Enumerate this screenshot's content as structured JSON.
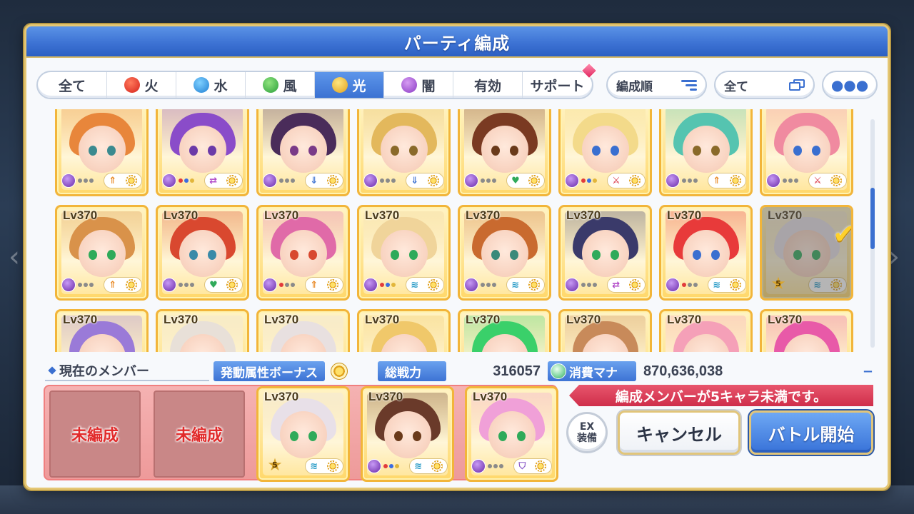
{
  "title": "パーティ編成",
  "tabs": [
    {
      "label": "全て",
      "icon": ""
    },
    {
      "label": "火",
      "icon": "fire-icon"
    },
    {
      "label": "水",
      "icon": "water-icon"
    },
    {
      "label": "風",
      "icon": "wind-icon"
    },
    {
      "label": "光",
      "icon": "light-icon",
      "active": true
    },
    {
      "label": "闇",
      "icon": "dark-icon"
    },
    {
      "label": "有効",
      "icon": ""
    },
    {
      "label": "サポート",
      "icon": ""
    }
  ],
  "sort_label": "編成順",
  "filter_label": "全て",
  "level_label": "Lv370",
  "rows": [
    {
      "show_level": false,
      "cards": [
        {
          "hair": "#e8863b",
          "eye": "#3b8a8f",
          "role": "up-arrow",
          "role_color": "#e8861f",
          "dots": [
            "g",
            "g",
            "g"
          ]
        },
        {
          "hair": "#8a4cc9",
          "eye": "#6b3aa8",
          "role": "swap",
          "role_color": "#b048c8",
          "dots": [
            "r",
            "b",
            "y"
          ]
        },
        {
          "hair": "#4a2c5a",
          "eye": "#7a3a88",
          "role": "down-arrow",
          "role_color": "#3a6fd0",
          "dots": [
            "g",
            "g",
            "g"
          ]
        },
        {
          "hair": "#e3b85c",
          "eye": "#8a6a2a",
          "role": "down-arrow",
          "role_color": "#3a6fd0",
          "dots": [
            "g",
            "g",
            "g"
          ]
        },
        {
          "hair": "#7a3a22",
          "eye": "#6a3a1a",
          "role": "heart",
          "role_color": "#2faa5a",
          "dots": [
            "g",
            "g",
            "g"
          ]
        },
        {
          "hair": "#f3da8a",
          "eye": "#3a6fd0",
          "role": "sword",
          "role_color": "#d82a3a",
          "dots": [
            "r",
            "b",
            "y"
          ]
        },
        {
          "hair": "#55c4b0",
          "eye": "#8a6a2a",
          "role": "up-arrow",
          "role_color": "#e8861f",
          "dots": [
            "g",
            "g",
            "g"
          ]
        },
        {
          "hair": "#f08aa0",
          "eye": "#3a6fd0",
          "role": "sword",
          "role_color": "#d82a3a",
          "dots": [
            "g",
            "g",
            "g"
          ]
        }
      ]
    },
    {
      "show_level": true,
      "cards": [
        {
          "hair": "#d9924a",
          "eye": "#2faa5a",
          "role": "up-arrow",
          "role_color": "#e8861f",
          "dots": [
            "g",
            "g",
            "g"
          ]
        },
        {
          "hair": "#d9482f",
          "eye": "#3a8aa8",
          "role": "heart",
          "role_color": "#2faa5a",
          "dots": [
            "g",
            "g",
            "g"
          ]
        },
        {
          "hair": "#e06aa8",
          "eye": "#d8482f",
          "role": "up-arrow",
          "role_color": "#e8861f",
          "dots": [
            "r",
            "g",
            "g"
          ]
        },
        {
          "hair": "#f0d49a",
          "eye": "#2faa5a",
          "role": "wing",
          "role_color": "#2a9cc8",
          "dots": [
            "r",
            "b",
            "y"
          ]
        },
        {
          "hair": "#c96a2f",
          "eye": "#3a8a7a",
          "role": "wing",
          "role_color": "#2a9cc8",
          "dots": [
            "g",
            "g",
            "g"
          ]
        },
        {
          "hair": "#3a3a6a",
          "eye": "#2faa5a",
          "role": "swap",
          "role_color": "#b048c8",
          "dots": [
            "g",
            "g",
            "g"
          ]
        },
        {
          "hair": "#e83a3a",
          "eye": "#3a6fd0",
          "role": "wing",
          "role_color": "#2a9cc8",
          "dots": [
            "r",
            "g",
            "g"
          ]
        },
        {
          "hair": "#e8e0e8",
          "eye": "#2faa5a",
          "role": "wing",
          "role_color": "#2a9cc8",
          "dots": [],
          "selected": true,
          "star": "5"
        }
      ]
    },
    {
      "show_level": true,
      "cards": [
        {
          "hair": "#9a7ad8",
          "eye": "#6a3aa8",
          "role": "",
          "role_color": "#888",
          "dots": []
        },
        {
          "hair": "#e8e0d8",
          "eye": "#8a6a2a",
          "role": "",
          "role_color": "#888",
          "dots": []
        },
        {
          "hair": "#e8e0e0",
          "eye": "#8a6a2a",
          "role": "",
          "role_color": "#888",
          "dots": []
        },
        {
          "hair": "#f0c86a",
          "eye": "#3a8a7a",
          "role": "",
          "role_color": "#888",
          "dots": []
        },
        {
          "hair": "#3ad06a",
          "eye": "#2a8a5a",
          "role": "",
          "role_color": "#888",
          "dots": []
        },
        {
          "hair": "#c88a5a",
          "eye": "#6a3a1a",
          "role": "",
          "role_color": "#888",
          "dots": []
        },
        {
          "hair": "#f5a0b8",
          "eye": "#8a3a6a",
          "role": "",
          "role_color": "#888",
          "dots": []
        },
        {
          "hair": "#e85aa8",
          "eye": "#8a3a6a",
          "role": "",
          "role_color": "#888",
          "dots": []
        }
      ]
    }
  ],
  "info": {
    "current_members": "現在のメンバー",
    "bonus_label": "発動属性ボーナス",
    "power_label": "総戦力",
    "power_value": "316057",
    "mana_label": "消費マナ",
    "mana_value": "870,636,038",
    "collapse": "−"
  },
  "party": {
    "empty_label": "未編成",
    "members": [
      {
        "hair": "#e8e0e8",
        "eye": "#2faa5a",
        "role": "wing",
        "role_color": "#2a9cc8",
        "dots": [],
        "star": "5"
      },
      {
        "hair": "#6a3a2a",
        "eye": "#6a3a1a",
        "role": "wing",
        "role_color": "#2a9cc8",
        "dots": [
          "r",
          "b",
          "y"
        ]
      },
      {
        "hair": "#f0a0d8",
        "eye": "#2faa5a",
        "role": "shield",
        "role_color": "#8a5ac8",
        "dots": [
          "g",
          "g",
          "g"
        ]
      }
    ]
  },
  "warning": "編成メンバーが5キャラ未満です。",
  "ex_button": [
    "EX",
    "装備"
  ],
  "cancel_label": "キャンセル",
  "battle_label": "バトル開始"
}
